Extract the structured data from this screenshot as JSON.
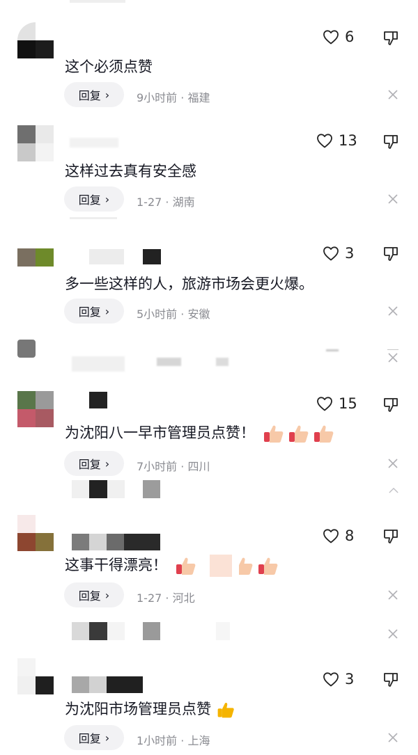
{
  "colors": {
    "text": "#161823",
    "meta": "#8a8b91",
    "reply_bg": "#f2f2f4",
    "icon": "#333333"
  },
  "comments": [
    {
      "likes": "6",
      "text": "这个必须点赞",
      "reply_label": "回复",
      "meta": "9小时前 · 福建"
    },
    {
      "likes": "13",
      "text": "这样过去真有安全感",
      "reply_label": "回复",
      "meta": "1-27 · 湖南"
    },
    {
      "likes": "3",
      "text": "多一些这样的人，旅游市场会更火爆。",
      "reply_label": "回复",
      "meta": "5小时前 · 安徽"
    },
    {
      "likes": "15",
      "text": "为沈阳八一早市管理员点赞！",
      "reply_label": "回复",
      "meta": "7小时前 · 四川"
    },
    {
      "likes": "8",
      "text": "这事干得漂亮！",
      "reply_label": "回复",
      "meta": "1-27 · 河北"
    },
    {
      "likes": "3",
      "text": "为沈阳市场管理员点赞",
      "reply_label": "回复",
      "meta": "1小时前 · 上海"
    }
  ]
}
